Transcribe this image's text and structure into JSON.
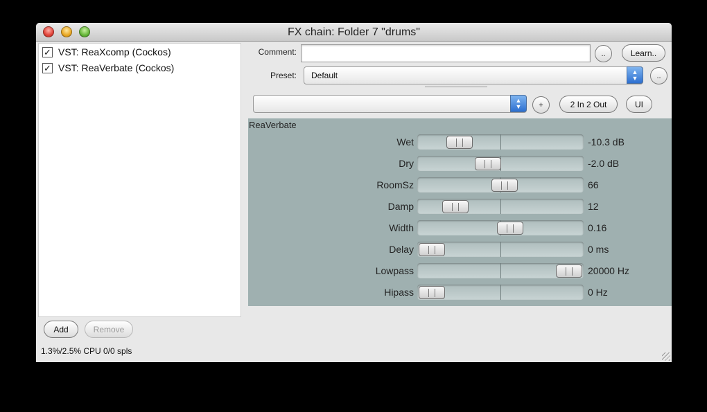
{
  "window": {
    "title": "FX chain: Folder 7 \"drums\""
  },
  "fx_list": [
    {
      "label": "VST: ReaXcomp (Cockos)",
      "checked": true
    },
    {
      "label": "VST: ReaVerbate (Cockos)",
      "checked": true
    }
  ],
  "buttons": {
    "add": "Add",
    "remove": "Remove",
    "learn": "Learn..",
    "comment_more": "..",
    "preset_more": "..",
    "plus": "+",
    "io": "2 In 2 Out",
    "ui": "UI"
  },
  "status": "1.3%/2.5% CPU 0/0 spls",
  "comment": {
    "label": "Comment:",
    "value": ""
  },
  "preset": {
    "label": "Preset:",
    "value": "Default"
  },
  "secondary_select": {
    "value": ""
  },
  "plugin": {
    "name": "ReaVerbate",
    "params": [
      {
        "label": "Wet",
        "value": "-10.3 dB",
        "position": 0.2
      },
      {
        "label": "Dry",
        "value": "-2.0 dB",
        "position": 0.41
      },
      {
        "label": "RoomSz",
        "value": "66",
        "position": 0.53
      },
      {
        "label": "Damp",
        "value": "12",
        "position": 0.17
      },
      {
        "label": "Width",
        "value": "0.16",
        "position": 0.57
      },
      {
        "label": "Delay",
        "value": "0 ms",
        "position": 0.0
      },
      {
        "label": "Lowpass",
        "value": "20000 Hz",
        "position": 1.0
      },
      {
        "label": "Hipass",
        "value": "0 Hz",
        "position": 0.0
      }
    ]
  }
}
